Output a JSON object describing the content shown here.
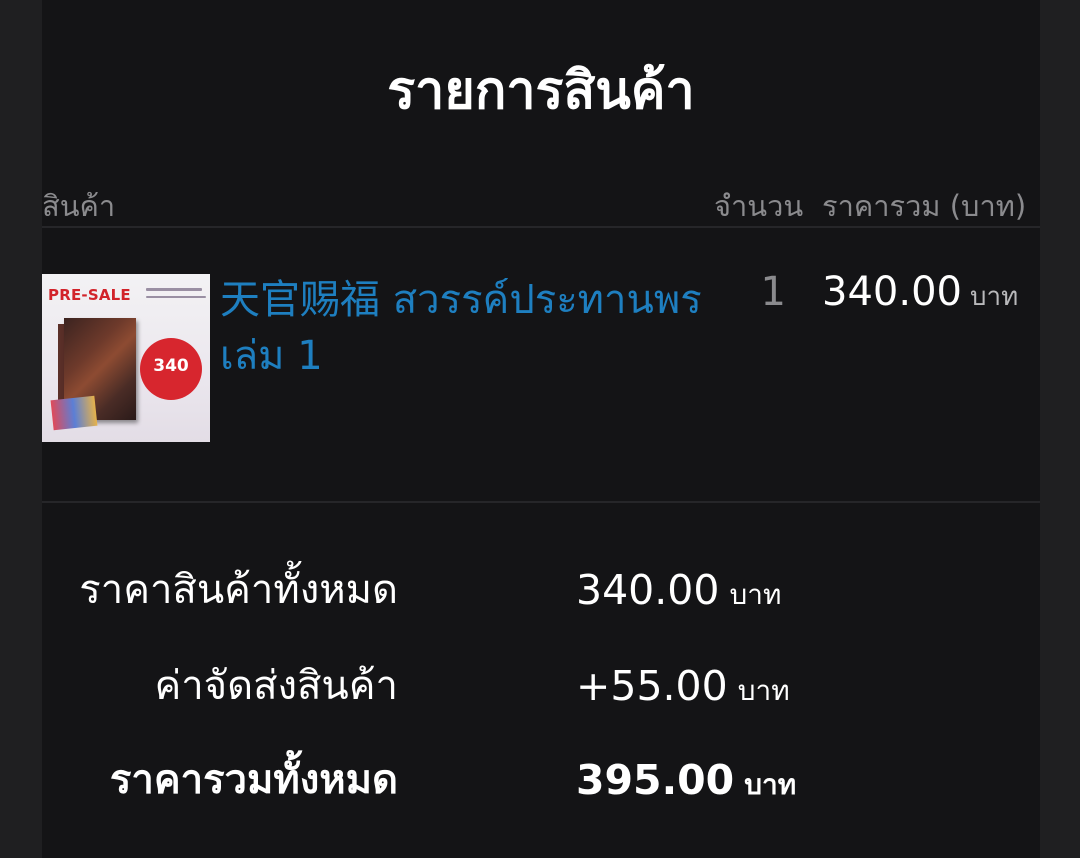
{
  "header": {
    "title": "รายการสินค้า"
  },
  "columns": {
    "product": "สินค้า",
    "quantity": "จำนวน",
    "total": "ราคารวม (บาท)"
  },
  "items": [
    {
      "name": "天官赐福 สวรรค์ประทานพร เล่ม 1",
      "quantity": "1",
      "price": "340.00",
      "unit": "บาท",
      "thumbnail": {
        "badge_text": "PRE-SALE",
        "price_badge": "340"
      }
    }
  ],
  "summary": {
    "subtotal": {
      "label": "ราคาสินค้าทั้งหมด",
      "value": "340.00",
      "unit": "บาท"
    },
    "shipping": {
      "label": "ค่าจัดส่งสินค้า",
      "value": "+55.00",
      "unit": "บาท"
    },
    "grand_total": {
      "label": "ราคารวมทั้งหมด",
      "value": "395.00",
      "unit": "บาท"
    }
  },
  "colors": {
    "background": "#1f1f21",
    "panel": "#141416",
    "link": "#1e7fc0",
    "muted": "#8b8b8e"
  }
}
